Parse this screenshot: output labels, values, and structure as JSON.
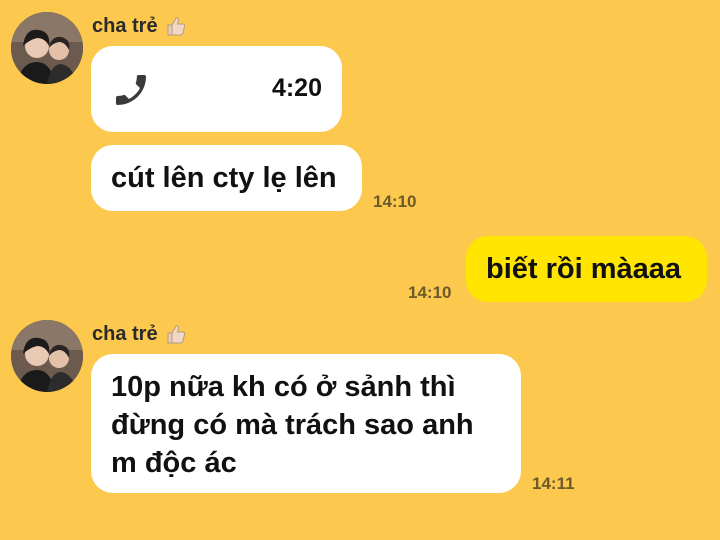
{
  "messages": [
    {
      "sender": "cha trẻ",
      "type": "call",
      "duration": "4:20"
    },
    {
      "sender": "cha trẻ",
      "type": "text",
      "text": "cút lên cty lẹ lên",
      "time": "14:10"
    },
    {
      "sender": "me",
      "type": "text",
      "text": "biết rồi màaaa",
      "time": "14:10"
    },
    {
      "sender": "cha trẻ",
      "type": "text",
      "text": "10p nữa kh có ở sảnh thì\nđừng có mà trách sao anh\nm độc ác",
      "time": "14:11"
    }
  ],
  "colors": {
    "background": "#FCC84D",
    "incoming_bubble": "#FFFFFF",
    "outgoing_bubble": "#FFE500"
  },
  "icons": {
    "reaction": "thumbs-up-icon",
    "call": "phone-icon"
  }
}
